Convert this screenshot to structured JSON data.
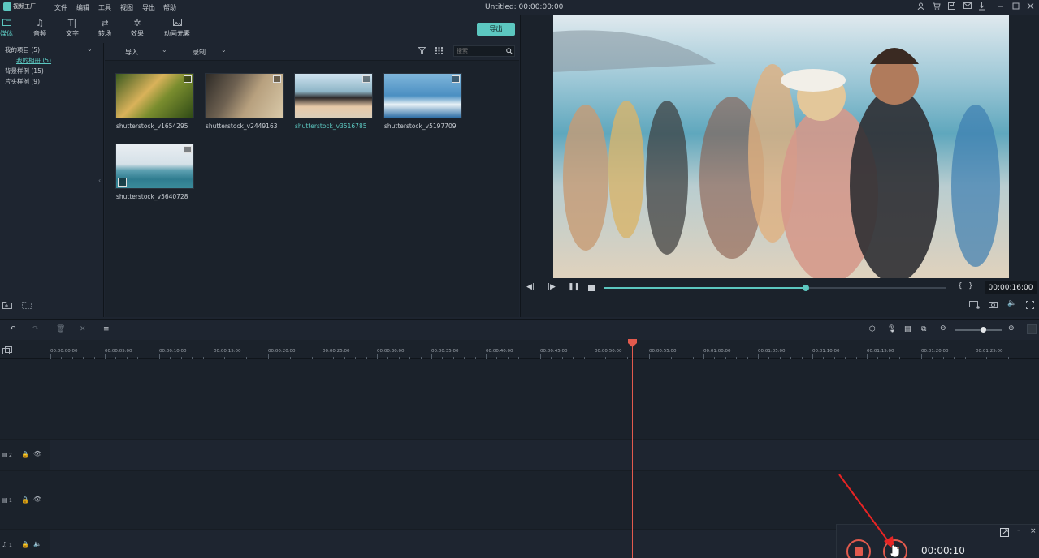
{
  "app": {
    "logo_text": "视频工厂",
    "menu": [
      "文件",
      "编辑",
      "工具",
      "视图",
      "导出",
      "帮助"
    ],
    "doc_title": "Untitled:  00:00:00:00"
  },
  "media_tabs": [
    {
      "label": "媒体",
      "icon": "folder-icon",
      "active": true
    },
    {
      "label": "音频",
      "icon": "music-note-icon"
    },
    {
      "label": "文字",
      "icon": "text-icon"
    },
    {
      "label": "转场",
      "icon": "transition-icon"
    },
    {
      "label": "效果",
      "icon": "effect-icon"
    },
    {
      "label": "动画元素",
      "icon": "image-icon"
    }
  ],
  "export_label": "导出",
  "left_tree": {
    "my_projects": "我的项目 (5)",
    "my_album": "我的相册 (5)",
    "background_samples": "背景样例 (15)",
    "intro_samples": "片头样例 (9)"
  },
  "library_toolbar": {
    "import_label": "导入",
    "record_label": "录制",
    "search_placeholder": "搜索"
  },
  "media_items": [
    {
      "name": "shutterstock_v1654295",
      "selected": false
    },
    {
      "name": "shutterstock_v2449163",
      "selected": false
    },
    {
      "name": "shutterstock_v3516785",
      "selected": true
    },
    {
      "name": "shutterstock_v5197709",
      "selected": false
    },
    {
      "name": "shutterstock_v5640728",
      "selected": false
    }
  ],
  "preview": {
    "timecode": "00:00:16:00",
    "progress_fraction": 0.59
  },
  "ruler_labels": [
    "00:00:00:00",
    "00:00:05:00",
    "00:00:10:00",
    "00:00:15:00",
    "00:00:20:00",
    "00:00:25:00",
    "00:00:30:00",
    "00:00:35:00",
    "00:00:40:00",
    "00:00:45:00",
    "00:00:50:00",
    "00:00:55:00",
    "00:01:00:00",
    "00:01:05:00",
    "00:01:10:00",
    "00:01:15:00",
    "00:01:20:00",
    "00:01:25:00"
  ],
  "tracks": [
    {
      "num": "2",
      "type": "video"
    },
    {
      "num": "1",
      "type": "video"
    },
    {
      "num": "1",
      "type": "audio"
    }
  ],
  "recorder": {
    "time": "00:00:10"
  },
  "colors": {
    "accent": "#5cc7c0",
    "playhead": "#e25a4d"
  }
}
